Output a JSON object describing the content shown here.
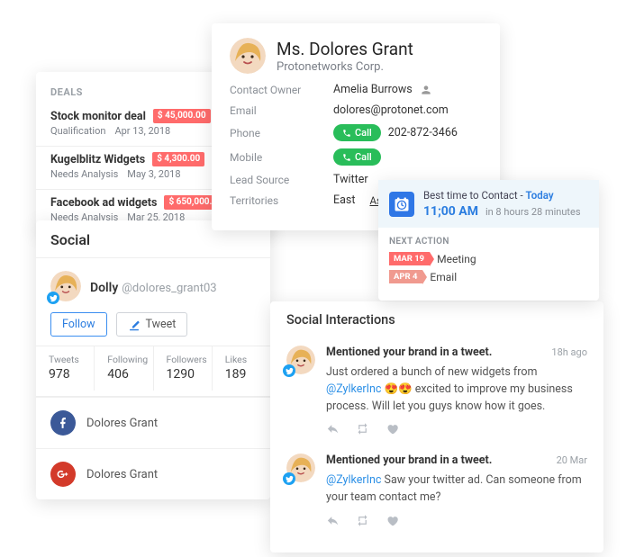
{
  "deals": {
    "title": "DEALS",
    "items": [
      {
        "name": "Stock monitor deal",
        "amount": "$ 45,000.00",
        "stage": "Qualification",
        "date": "Apr 13, 2018"
      },
      {
        "name": "Kugelblitz Widgets",
        "amount": "$ 4,300.00",
        "stage": "Needs Analysis",
        "date": "May 3, 2018"
      },
      {
        "name": "Facebook ad widgets",
        "amount": "$ 650,000.00",
        "stage": "Needs Analysis",
        "date": "Mar 25, 2018"
      }
    ]
  },
  "social": {
    "title": "Social",
    "twitter": {
      "display_name": "Dolly",
      "handle": "@dolores_grant03",
      "follow_label": "Follow",
      "tweet_label": "Tweet",
      "stats": {
        "tweets_label": "Tweets",
        "tweets": "978",
        "following_label": "Following",
        "following": "406",
        "followers_label": "Followers",
        "followers": "1290",
        "likes_label": "Likes",
        "likes": "189"
      }
    },
    "facebook_name": "Dolores Grant",
    "google_name": "Dolores Grant"
  },
  "contact": {
    "name": "Ms. Dolores Grant",
    "company": "Protonetworks Corp.",
    "rows": {
      "owner_label": "Contact Owner",
      "owner": "Amelia Burrows",
      "email_label": "Email",
      "email": "dolores@protonet.com",
      "phone_label": "Phone",
      "phone": "202-872-3466",
      "mobile_label": "Mobile",
      "lead_source_label": "Lead Source",
      "lead_source": "Twitter",
      "territories_label": "Territories",
      "territories": "East",
      "assign_label": "Assig..."
    },
    "call_label": "Call"
  },
  "best_time": {
    "label": "Best time to Contact - ",
    "today": "Today",
    "time": "11;00 AM",
    "sub": "in 8 hours 28 minutes",
    "next_action_title": "NEXT ACTION",
    "actions": [
      {
        "date": "MAR 19",
        "text": "Meeting",
        "flag": "mar"
      },
      {
        "date": "APR 4",
        "text": "Email",
        "flag": "apr"
      }
    ]
  },
  "feed": {
    "title": "Social Interactions",
    "tweets": [
      {
        "heading": "Mentioned your brand in a tweet.",
        "time": "18h ago",
        "pre": "Just ordered a bunch of new widgets from ",
        "mention": "@ZylkerInc",
        "post": " 😍😍 excited to improve my business process. Will let you guys know how it goes."
      },
      {
        "heading": "Mentioned your brand in a tweet.",
        "time": "20 Mar",
        "pre": "",
        "mention": "@ZylkerInc",
        "post": " Saw your twitter ad. Can someone from your team contact me?"
      }
    ]
  }
}
